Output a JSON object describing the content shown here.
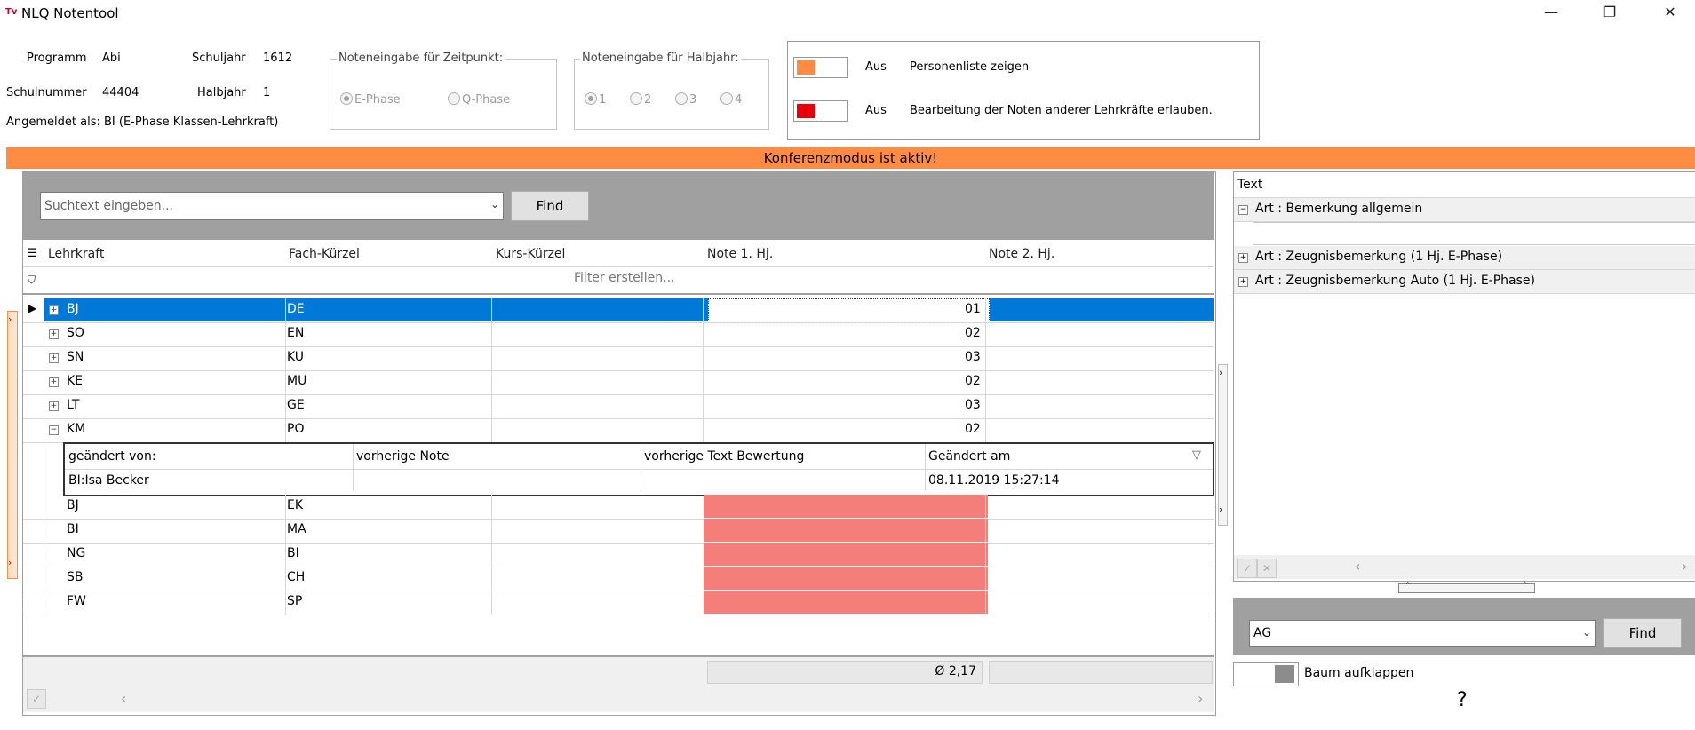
{
  "window": {
    "title": "NLQ Notentool",
    "minimize": "—",
    "restore": "❐",
    "close": "✕"
  },
  "info": {
    "programm_label": "Programm",
    "programm_value": "Abi",
    "schuljahr_label": "Schuljahr",
    "schuljahr_value": "1612",
    "schulnummer_label": "Schulnummer",
    "schulnummer_value": "44404",
    "halbjahr_label": "Halbjahr",
    "halbjahr_value": "1",
    "angemeldet": "Angemeldet als: BI (E-Phase Klassen-Lehrkraft)"
  },
  "zeitpunkt": {
    "title": "Noteneingabe für Zeitpunkt:",
    "options": [
      "E-Phase",
      "Q-Phase"
    ],
    "selected": "E-Phase"
  },
  "halbjahr_group": {
    "title": "Noteneingabe für Halbjahr:",
    "options": [
      "1",
      "2",
      "3",
      "4"
    ],
    "selected": "1"
  },
  "toggles": [
    {
      "state": "Aus",
      "label": "Personenliste zeigen",
      "color": "#ff8c42"
    },
    {
      "state": "Aus",
      "label": "Bearbeitung der Noten anderer Lehrkräfte erlauben.",
      "color": "#e8000b"
    }
  ],
  "banner": {
    "text": "Konferenzmodus ist aktiv!",
    "color": "#ff8c42"
  },
  "search": {
    "placeholder": "Suchtext eingeben...",
    "find_label": "Find"
  },
  "grid": {
    "columns": [
      "Lehrkraft",
      "Fach-Kürzel",
      "Kurs-Kürzel",
      "Note 1. Hj.",
      "Note 2. Hj."
    ],
    "filter_text": "Filter erstellen...",
    "rows": [
      {
        "lehrkraft": "BJ",
        "fach": "DE",
        "kurs": "",
        "note1": "01",
        "note2": ""
      },
      {
        "lehrkraft": "SO",
        "fach": "EN",
        "kurs": "",
        "note1": "02",
        "note2": ""
      },
      {
        "lehrkraft": "SN",
        "fach": "KU",
        "kurs": "",
        "note1": "03",
        "note2": ""
      },
      {
        "lehrkraft": "KE",
        "fach": "MU",
        "kurs": "",
        "note1": "02",
        "note2": ""
      },
      {
        "lehrkraft": "LT",
        "fach": "GE",
        "kurs": "",
        "note1": "03",
        "note2": ""
      },
      {
        "lehrkraft": "KM",
        "fach": "PO",
        "kurs": "",
        "note1": "02",
        "note2": ""
      },
      {
        "lehrkraft": "BJ",
        "fach": "EK",
        "kurs": "",
        "note1": "",
        "note2": ""
      },
      {
        "lehrkraft": "BI",
        "fach": "MA",
        "kurs": "",
        "note1": "",
        "note2": ""
      },
      {
        "lehrkraft": "NG",
        "fach": "BI",
        "kurs": "",
        "note1": "",
        "note2": ""
      },
      {
        "lehrkraft": "SB",
        "fach": "CH",
        "kurs": "",
        "note1": "",
        "note2": ""
      },
      {
        "lehrkraft": "FW",
        "fach": "SP",
        "kurs": "",
        "note1": "",
        "note2": ""
      }
    ],
    "detail": {
      "columns": [
        "geändert von:",
        "vorherige Note",
        "vorherige Text Bewertung",
        "Geändert am"
      ],
      "row": [
        "BI:Isa Becker",
        "",
        "",
        "08.11.2019 15:27:14"
      ]
    },
    "average": "Ø 2,17"
  },
  "right": {
    "header": "Text",
    "items": [
      {
        "sign": "⊟",
        "label": "Art : Bemerkung allgemein"
      },
      {
        "sign": "⊞",
        "label": "Art : Zeugnisbemerkung (1 Hj. E-Phase)"
      },
      {
        "sign": "⊞",
        "label": "Art : Zeugnisbemerkung Auto (1 Hj. E-Phase)"
      }
    ],
    "combo_value": "AG",
    "find_label": "Find",
    "tree_toggle_label": "Baum aufklappen",
    "help": "?"
  }
}
